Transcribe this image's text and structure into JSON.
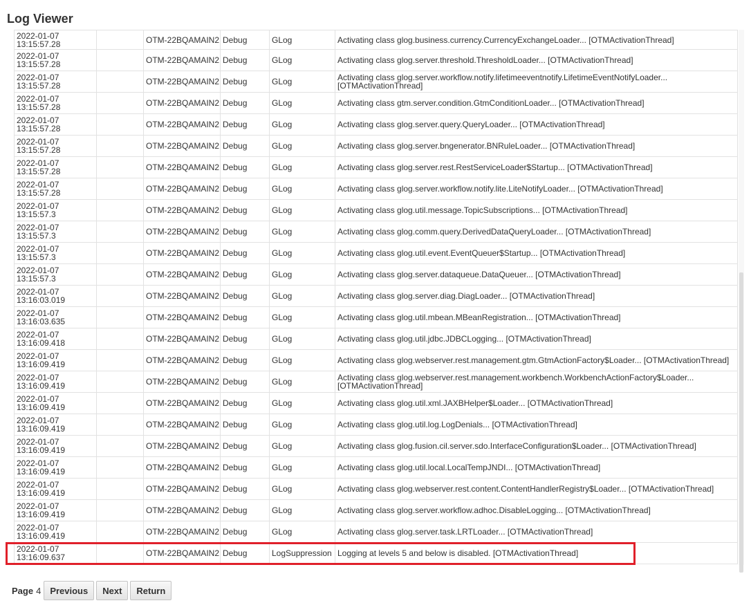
{
  "page": {
    "title": "Log Viewer"
  },
  "rows": [
    {
      "date": "2022-01-07",
      "time": "13:15:57.28",
      "col2": "",
      "host": "OTM-22BQAMAIN2",
      "level": "Debug",
      "category": "GLog",
      "message": "Activating class glog.business.currency.CurrencyExchangeLoader... [OTMActivationThread]"
    },
    {
      "date": "2022-01-07",
      "time": "13:15:57.28",
      "col2": "",
      "host": "OTM-22BQAMAIN2",
      "level": "Debug",
      "category": "GLog",
      "message": "Activating class glog.server.threshold.ThresholdLoader... [OTMActivationThread]"
    },
    {
      "date": "2022-01-07",
      "time": "13:15:57.28",
      "col2": "",
      "host": "OTM-22BQAMAIN2",
      "level": "Debug",
      "category": "GLog",
      "message": "Activating class glog.server.workflow.notify.lifetimeeventnotify.LifetimeEventNotifyLoader... [OTMActivationThread]"
    },
    {
      "date": "2022-01-07",
      "time": "13:15:57.28",
      "col2": "",
      "host": "OTM-22BQAMAIN2",
      "level": "Debug",
      "category": "GLog",
      "message": "Activating class gtm.server.condition.GtmConditionLoader... [OTMActivationThread]"
    },
    {
      "date": "2022-01-07",
      "time": "13:15:57.28",
      "col2": "",
      "host": "OTM-22BQAMAIN2",
      "level": "Debug",
      "category": "GLog",
      "message": "Activating class glog.server.query.QueryLoader... [OTMActivationThread]"
    },
    {
      "date": "2022-01-07",
      "time": "13:15:57.28",
      "col2": "",
      "host": "OTM-22BQAMAIN2",
      "level": "Debug",
      "category": "GLog",
      "message": "Activating class glog.server.bngenerator.BNRuleLoader... [OTMActivationThread]"
    },
    {
      "date": "2022-01-07",
      "time": "13:15:57.28",
      "col2": "",
      "host": "OTM-22BQAMAIN2",
      "level": "Debug",
      "category": "GLog",
      "message": "Activating class glog.server.rest.RestServiceLoader$Startup... [OTMActivationThread]"
    },
    {
      "date": "2022-01-07",
      "time": "13:15:57.28",
      "col2": "",
      "host": "OTM-22BQAMAIN2",
      "level": "Debug",
      "category": "GLog",
      "message": "Activating class glog.server.workflow.notify.lite.LiteNotifyLoader... [OTMActivationThread]"
    },
    {
      "date": "2022-01-07",
      "time": "13:15:57.3",
      "col2": "",
      "host": "OTM-22BQAMAIN2",
      "level": "Debug",
      "category": "GLog",
      "message": "Activating class glog.util.message.TopicSubscriptions... [OTMActivationThread]"
    },
    {
      "date": "2022-01-07",
      "time": "13:15:57.3",
      "col2": "",
      "host": "OTM-22BQAMAIN2",
      "level": "Debug",
      "category": "GLog",
      "message": "Activating class glog.comm.query.DerivedDataQueryLoader... [OTMActivationThread]"
    },
    {
      "date": "2022-01-07",
      "time": "13:15:57.3",
      "col2": "",
      "host": "OTM-22BQAMAIN2",
      "level": "Debug",
      "category": "GLog",
      "message": "Activating class glog.util.event.EventQueuer$Startup... [OTMActivationThread]"
    },
    {
      "date": "2022-01-07",
      "time": "13:15:57.3",
      "col2": "",
      "host": "OTM-22BQAMAIN2",
      "level": "Debug",
      "category": "GLog",
      "message": "Activating class glog.server.dataqueue.DataQueuer... [OTMActivationThread]"
    },
    {
      "date": "2022-01-07",
      "time": "13:16:03.019",
      "col2": "",
      "host": "OTM-22BQAMAIN2",
      "level": "Debug",
      "category": "GLog",
      "message": "Activating class glog.server.diag.DiagLoader... [OTMActivationThread]"
    },
    {
      "date": "2022-01-07",
      "time": "13:16:03.635",
      "col2": "",
      "host": "OTM-22BQAMAIN2",
      "level": "Debug",
      "category": "GLog",
      "message": "Activating class glog.util.mbean.MBeanRegistration... [OTMActivationThread]"
    },
    {
      "date": "2022-01-07",
      "time": "13:16:09.418",
      "col2": "",
      "host": "OTM-22BQAMAIN2",
      "level": "Debug",
      "category": "GLog",
      "message": "Activating class glog.util.jdbc.JDBCLogging... [OTMActivationThread]"
    },
    {
      "date": "2022-01-07",
      "time": "13:16:09.419",
      "col2": "",
      "host": "OTM-22BQAMAIN2",
      "level": "Debug",
      "category": "GLog",
      "message": "Activating class glog.webserver.rest.management.gtm.GtmActionFactory$Loader... [OTMActivationThread]"
    },
    {
      "date": "2022-01-07",
      "time": "13:16:09.419",
      "col2": "",
      "host": "OTM-22BQAMAIN2",
      "level": "Debug",
      "category": "GLog",
      "message": "Activating class glog.webserver.rest.management.workbench.WorkbenchActionFactory$Loader... [OTMActivationThread]"
    },
    {
      "date": "2022-01-07",
      "time": "13:16:09.419",
      "col2": "",
      "host": "OTM-22BQAMAIN2",
      "level": "Debug",
      "category": "GLog",
      "message": "Activating class glog.util.xml.JAXBHelper$Loader... [OTMActivationThread]"
    },
    {
      "date": "2022-01-07",
      "time": "13:16:09.419",
      "col2": "",
      "host": "OTM-22BQAMAIN2",
      "level": "Debug",
      "category": "GLog",
      "message": "Activating class glog.util.log.LogDenials... [OTMActivationThread]"
    },
    {
      "date": "2022-01-07",
      "time": "13:16:09.419",
      "col2": "",
      "host": "OTM-22BQAMAIN2",
      "level": "Debug",
      "category": "GLog",
      "message": "Activating class glog.fusion.cil.server.sdo.InterfaceConfiguration$Loader... [OTMActivationThread]"
    },
    {
      "date": "2022-01-07",
      "time": "13:16:09.419",
      "col2": "",
      "host": "OTM-22BQAMAIN2",
      "level": "Debug",
      "category": "GLog",
      "message": "Activating class glog.util.local.LocalTempJNDI... [OTMActivationThread]"
    },
    {
      "date": "2022-01-07",
      "time": "13:16:09.419",
      "col2": "",
      "host": "OTM-22BQAMAIN2",
      "level": "Debug",
      "category": "GLog",
      "message": "Activating class glog.webserver.rest.content.ContentHandlerRegistry$Loader... [OTMActivationThread]"
    },
    {
      "date": "2022-01-07",
      "time": "13:16:09.419",
      "col2": "",
      "host": "OTM-22BQAMAIN2",
      "level": "Debug",
      "category": "GLog",
      "message": "Activating class glog.server.workflow.adhoc.DisableLogging... [OTMActivationThread]"
    },
    {
      "date": "2022-01-07",
      "time": "13:16:09.419",
      "col2": "",
      "host": "OTM-22BQAMAIN2",
      "level": "Debug",
      "category": "GLog",
      "message": "Activating class glog.server.task.LRTLoader... [OTMActivationThread]"
    },
    {
      "date": "2022-01-07",
      "time": "13:16:09.637",
      "col2": "",
      "host": "OTM-22BQAMAIN2",
      "level": "Debug",
      "category": "LogSuppression",
      "message": "Logging at levels 5 and below is disabled. [OTMActivationThread]"
    }
  ],
  "pager": {
    "page_label": "Page",
    "page_number": "4",
    "previous_label": "Previous",
    "next_label": "Next",
    "return_label": "Return"
  },
  "colors": {
    "highlight": "#e0202a",
    "border": "#e2e2e2",
    "text": "#333333"
  }
}
